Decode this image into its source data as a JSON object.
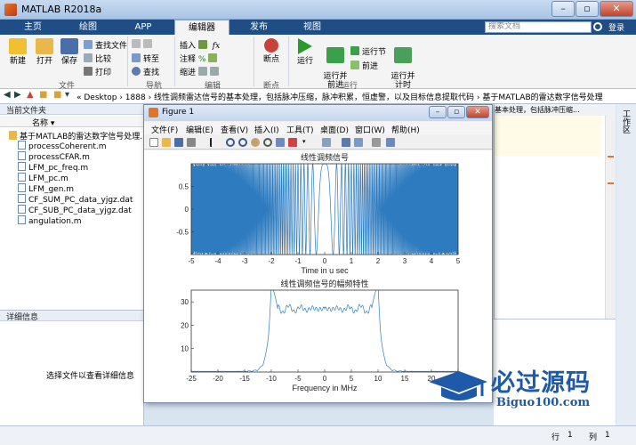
{
  "app": {
    "title": "MATLAB R2018a"
  },
  "tabs": [
    "主页",
    "绘图",
    "APP",
    "编辑器",
    "发布",
    "视图"
  ],
  "active_tab": "编辑器",
  "search": {
    "placeholder": "搜索文档"
  },
  "help_link": "登录",
  "ribbon": {
    "file": {
      "new": "新建",
      "open": "打开",
      "save": "保存",
      "find_files": "查找文件",
      "compare": "比较",
      "print": "打印",
      "group": "文件"
    },
    "navigate": {
      "goto": "转至",
      "find": "查找",
      "group": "导航"
    },
    "edit": {
      "insert": "插入",
      "comment": "注释",
      "indent": "缩进",
      "group": "编辑"
    },
    "breakpoints": {
      "label": "断点",
      "group": "断点"
    },
    "run": {
      "run": "运行",
      "run_advance": "运行并\n前进",
      "run_section": "运行节",
      "advance": "前进",
      "run_time": "运行并\n计时",
      "group": "运行"
    }
  },
  "address": {
    "path": "« Desktop › 1888 › 线性调频雷达信号的基本处理，包括脉冲压缩，脉冲积累，恒虚警，以及目标信息提取代码 › 基于MATLAB的雷达数字信号处理"
  },
  "current_folder": {
    "title": "当前文件夹",
    "column": "名称 ▾",
    "files": [
      "基于MATLAB的雷达数字信号处理...",
      "processCoherent.m",
      "processCFAR.m",
      "LFM_pc_freq.m",
      "LFM_pc.m",
      "LFM_gen.m",
      "CF_SUM_PC_data_yjgz.dat",
      "CF_SUB_PC_data_yjgz.dat",
      "angulation.m"
    ]
  },
  "details": {
    "title": "详细信息",
    "hint": "选择文件以查看详细信息"
  },
  "editor": {
    "tab": "基本处理，包括脉冲压缩..."
  },
  "side_tab": "工作区",
  "statusbar": {
    "row_label": "行",
    "row": "1",
    "col_label": "列",
    "col": "1"
  },
  "figure": {
    "title": "Figure 1",
    "menu": [
      "文件(F)",
      "编辑(E)",
      "查看(V)",
      "插入(I)",
      "工具(T)",
      "桌面(D)",
      "窗口(W)",
      "帮助(H)"
    ]
  },
  "chart_data": [
    {
      "type": "line",
      "title": "线性调频信号",
      "xlabel": "Time in u sec",
      "ylabel": "",
      "xlim": [
        -5,
        5
      ],
      "ylim": [
        -1,
        1
      ],
      "xticks": [
        -5,
        -4,
        -3,
        -2,
        -1,
        0,
        1,
        2,
        3,
        4,
        5
      ],
      "yticks": [
        -0.5,
        0,
        0.5
      ],
      "function": "cos(pi*k*t^2)",
      "chirp_rate": 10,
      "grid": false
    },
    {
      "type": "line",
      "title": "线性调频信号的幅频特性",
      "xlabel": "Frequency in MHz",
      "ylabel": "",
      "xlim": [
        -25,
        25
      ],
      "ylim": [
        0,
        35
      ],
      "xticks": [
        -25,
        -20,
        -15,
        -10,
        -5,
        0,
        5,
        10,
        15,
        20,
        25
      ],
      "yticks": [
        10,
        20,
        30
      ],
      "band_edges": [
        -10,
        10
      ],
      "passband_level": 27,
      "edge_peak": 36,
      "grid": false
    }
  ],
  "watermark": {
    "text": "必过源码",
    "url": "Biguo100.com"
  },
  "colors": {
    "tab_bar": "#1f4e86",
    "plot_line": "#2e7bbf",
    "watermark": "#1f5aa8"
  }
}
